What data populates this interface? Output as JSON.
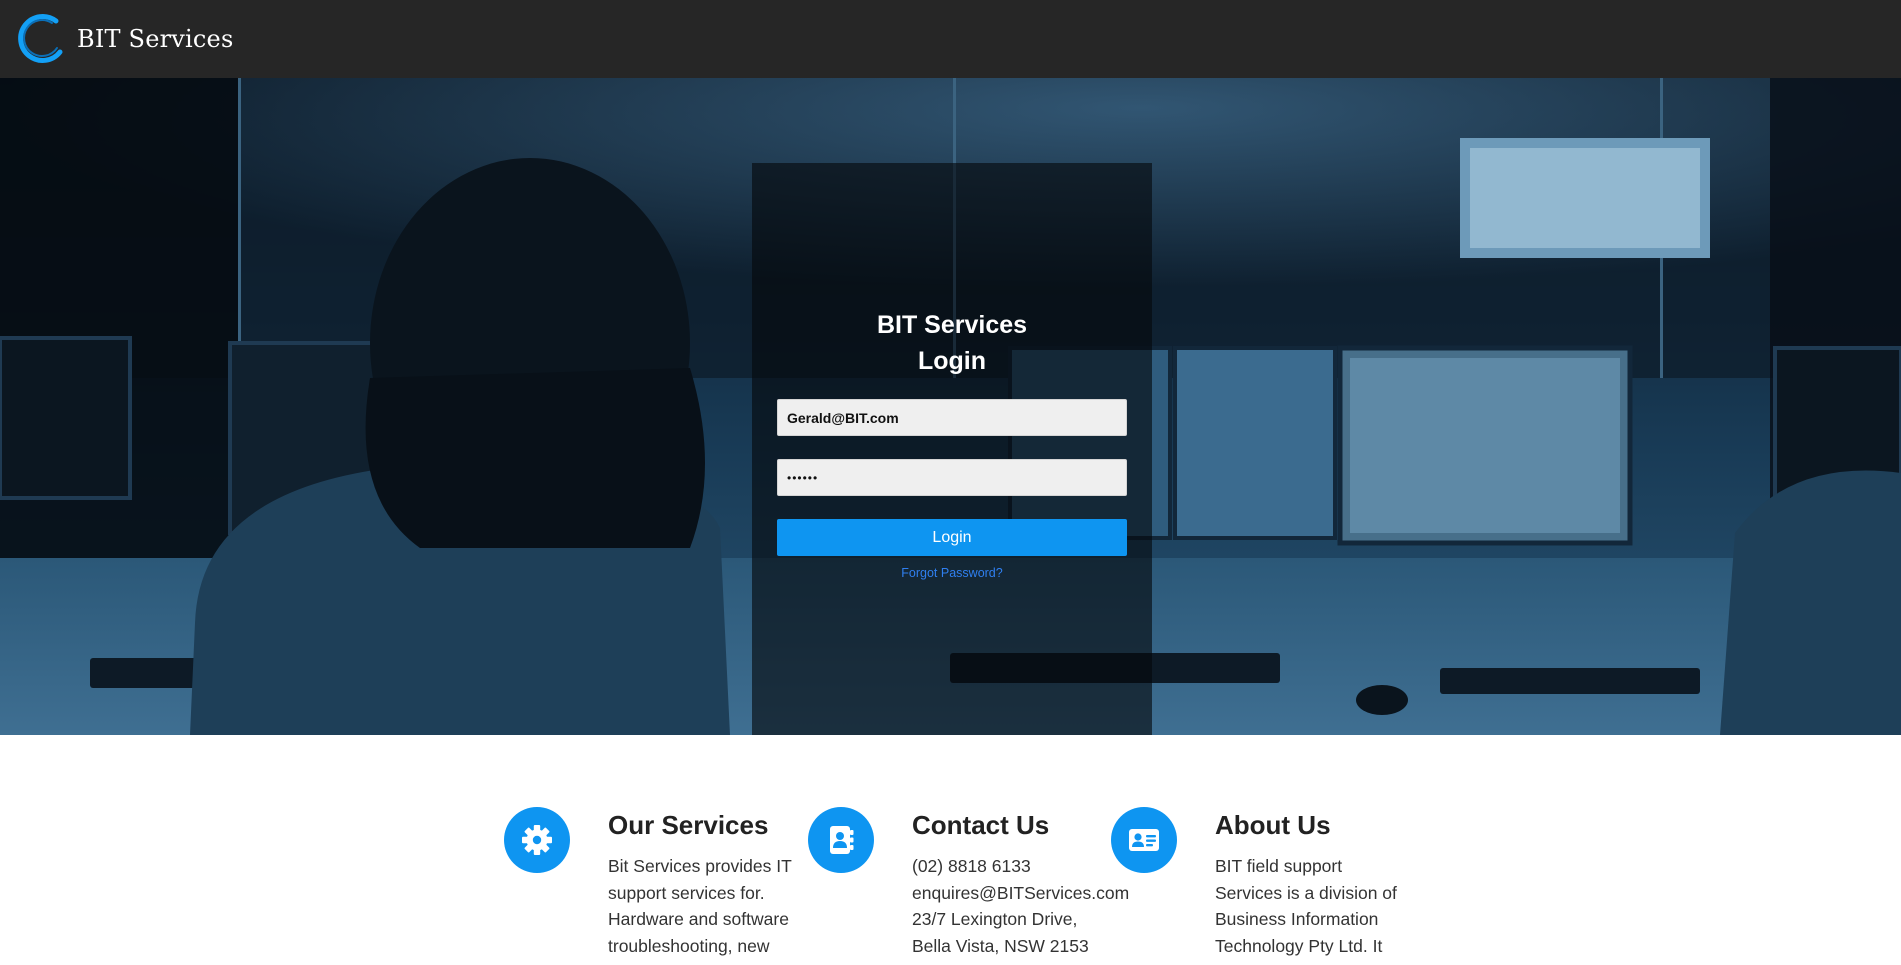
{
  "navbar": {
    "brand_text": "BIT Services"
  },
  "login": {
    "title_line1": "BIT Services",
    "title_line2": "Login",
    "email_value": "Gerald@BIT.com",
    "password_value": "••••••",
    "button_label": "Login",
    "forgot_link": "Forgot Password?"
  },
  "sections": [
    {
      "icon": "gear-icon",
      "heading": "Our Services",
      "lines": [
        "Bit Services provides IT",
        "support services for.",
        "Hardware and software",
        "troubleshooting, new"
      ]
    },
    {
      "icon": "address-book-icon",
      "heading": "Contact Us",
      "lines": [
        "(02) 8818 6133",
        "enquires@BITServices.com",
        "23/7 Lexington Drive,",
        "Bella Vista, NSW 2153"
      ]
    },
    {
      "icon": "id-card-icon",
      "heading": "About Us",
      "lines": [
        "BIT field support",
        "Services is a division of",
        "Business Information",
        "Technology Pty Ltd. It"
      ]
    }
  ],
  "colors": {
    "navbar_bg": "#262626",
    "accent_blue": "#0e95f1",
    "link_blue": "#2f7ff0",
    "hero_tint": "#1b3d57"
  }
}
